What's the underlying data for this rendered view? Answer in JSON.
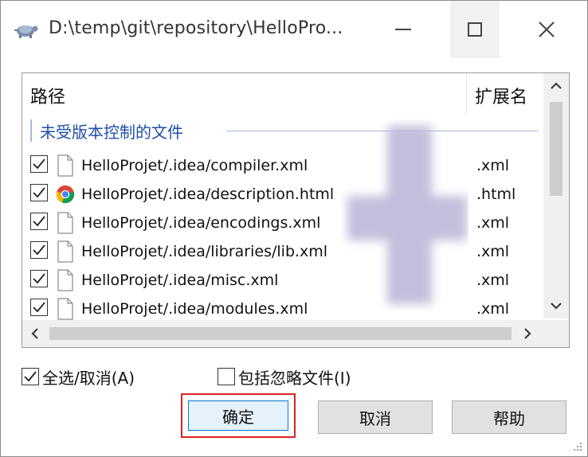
{
  "window": {
    "title": "D:\\temp\\git\\repository\\HelloPro...",
    "icon": "tortoise-icon"
  },
  "list": {
    "headers": {
      "path": "路径",
      "extension": "扩展名"
    },
    "group_label": "未受版本控制的文件",
    "rows": [
      {
        "checked": true,
        "icon": "file-icon",
        "name": "HelloProjet/.idea/compiler.xml",
        "ext": ".xml"
      },
      {
        "checked": true,
        "icon": "chrome-icon",
        "name": "HelloProjet/.idea/description.html",
        "ext": ".html"
      },
      {
        "checked": true,
        "icon": "file-icon",
        "name": "HelloProjet/.idea/encodings.xml",
        "ext": ".xml"
      },
      {
        "checked": true,
        "icon": "file-icon",
        "name": "HelloProjet/.idea/libraries/lib.xml",
        "ext": ".xml"
      },
      {
        "checked": true,
        "icon": "file-icon",
        "name": "HelloProjet/.idea/misc.xml",
        "ext": ".xml"
      },
      {
        "checked": true,
        "icon": "file-icon",
        "name": "HelloProjet/.idea/modules.xml",
        "ext": ".xml"
      }
    ]
  },
  "options": {
    "select_all": {
      "label": "全选/取消(A)",
      "checked": true
    },
    "include_ignored": {
      "label": "包括忽略文件(I)",
      "checked": false
    }
  },
  "buttons": {
    "ok": "确定",
    "cancel": "取消",
    "help": "帮助"
  },
  "colors": {
    "highlight_border": "#e02020",
    "group_label": "#1f4fa8",
    "watermark": "#b7b4d6"
  }
}
